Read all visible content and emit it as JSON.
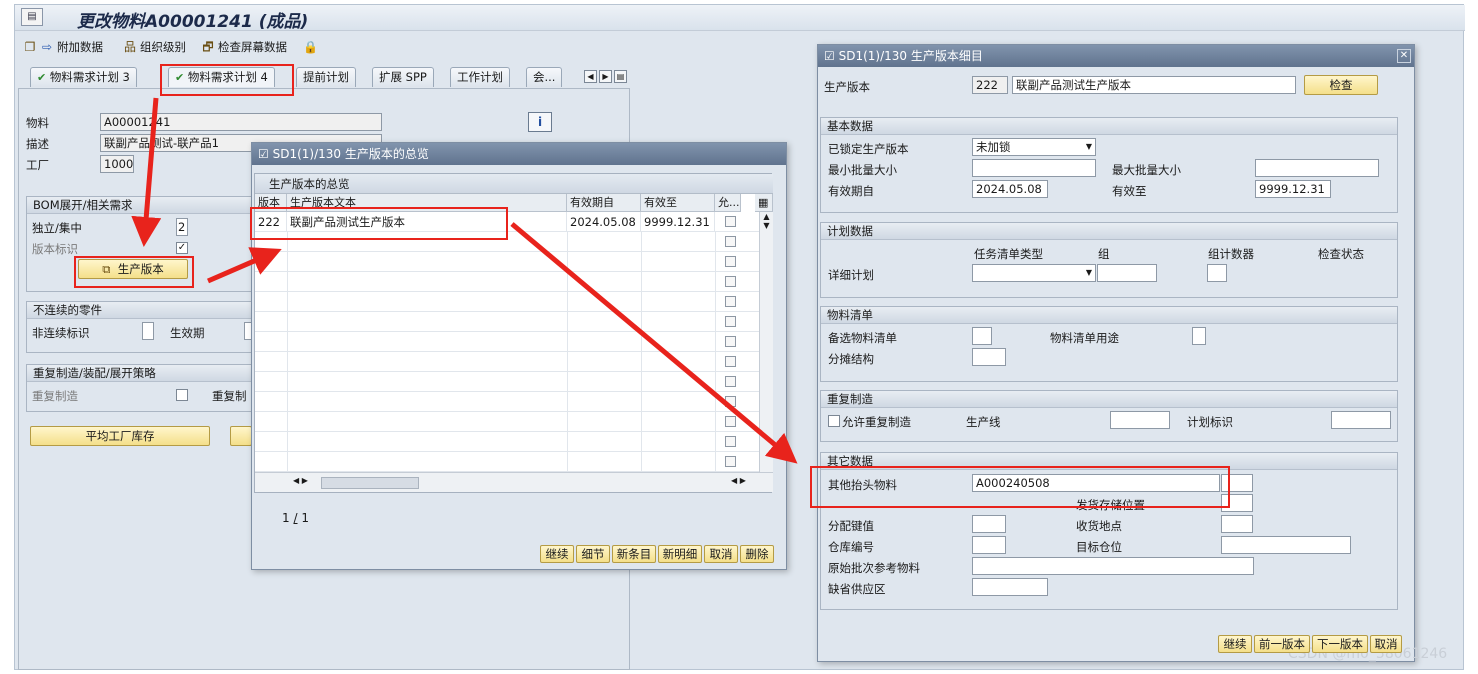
{
  "title": "更改物料A00001241 (成品)",
  "toolbar": {
    "additional_data": "附加数据",
    "org_levels": "组织级别",
    "check_screen": "检查屏幕数据"
  },
  "tabs": [
    "物料需求计划 3",
    "物料需求计划 4",
    "提前计划",
    "扩展 SPP",
    "工作计划",
    "会..."
  ],
  "left": {
    "material_label": "物料",
    "material_value": "A00001241",
    "desc_label": "描述",
    "desc_value": "联副产品测试-联产品1",
    "plant_label": "工厂",
    "plant_value": "1000",
    "bom_group": "BOM展开/相关需求",
    "indiv_label": "独立/集中",
    "indiv_value": "2",
    "version_label": "版本标识",
    "prod_version_btn": "生产版本",
    "disc_group": "不连续的零件",
    "disc_label": "非连续标识",
    "effective_label": "生效期",
    "rep_group": "重复制造/装配/展开策略",
    "rep_label": "重复制造",
    "rep_label2": "重复制",
    "avg_stock_btn": "平均工厂库存"
  },
  "overview": {
    "title": "SD1(1)/130 生产版本的总览",
    "table_title": "生产版本的总览",
    "columns": [
      "版本",
      "生产版本文本",
      "有效期自",
      "有效至",
      "允..."
    ],
    "rows": [
      {
        "version": "222",
        "text": "联副产品测试生产版本",
        "from": "2024.05.08",
        "to": "9999.12.31"
      }
    ],
    "page": "1",
    "page_sep": "/",
    "page_total": "1",
    "buttons": [
      "继续",
      "细节",
      "新条目",
      "新明细",
      "取消",
      "删除"
    ]
  },
  "detail": {
    "title": "SD1(1)/130 生产版本细目",
    "prod_version_label": "生产版本",
    "prod_version_value": "222",
    "prod_version_text": "联副产品测试生产版本",
    "check_btn": "检查",
    "basic_group": "基本数据",
    "locked_label": "已锁定生产版本",
    "locked_value": "未加锁",
    "min_lot_label": "最小批量大小",
    "max_lot_label": "最大批量大小",
    "valid_from_label": "有效期自",
    "valid_from_value": "2024.05.08",
    "valid_to_label": "有效至",
    "valid_to_value": "9999.12.31",
    "planning_group": "计划数据",
    "task_list_type": "任务清单类型",
    "group_label": "组",
    "group_counter": "组计数器",
    "check_status": "检查状态",
    "detail_plan": "详细计划",
    "bom_group": "物料清单",
    "alt_bom": "备选物料清单",
    "bom_usage": "物料清单用途",
    "apportion": "分摊结构",
    "rep_group": "重复制造",
    "allow_rep": "允许重复制造",
    "prod_line": "生产线",
    "planning_id": "计划标识",
    "other_group": "其它数据",
    "other_header_mat": "其他抬头物料",
    "other_header_value": "A000240508",
    "issue_storage": "发货存储位置",
    "distribution_key": "分配键值",
    "receiving_point": "收货地点",
    "warehouse_no": "仓库编号",
    "dest_bin": "目标仓位",
    "orig_batch_ref": "原始批次参考物料",
    "supply_area": "缺省供应区",
    "buttons": [
      "继续",
      "前一版本",
      "下一版本",
      "取消"
    ]
  },
  "watermark": "CSDN @m0_58061246",
  "colors": {
    "annotation": "#e8231c",
    "button_yellow": "#f4df8a",
    "title_blue": "#60738e"
  }
}
